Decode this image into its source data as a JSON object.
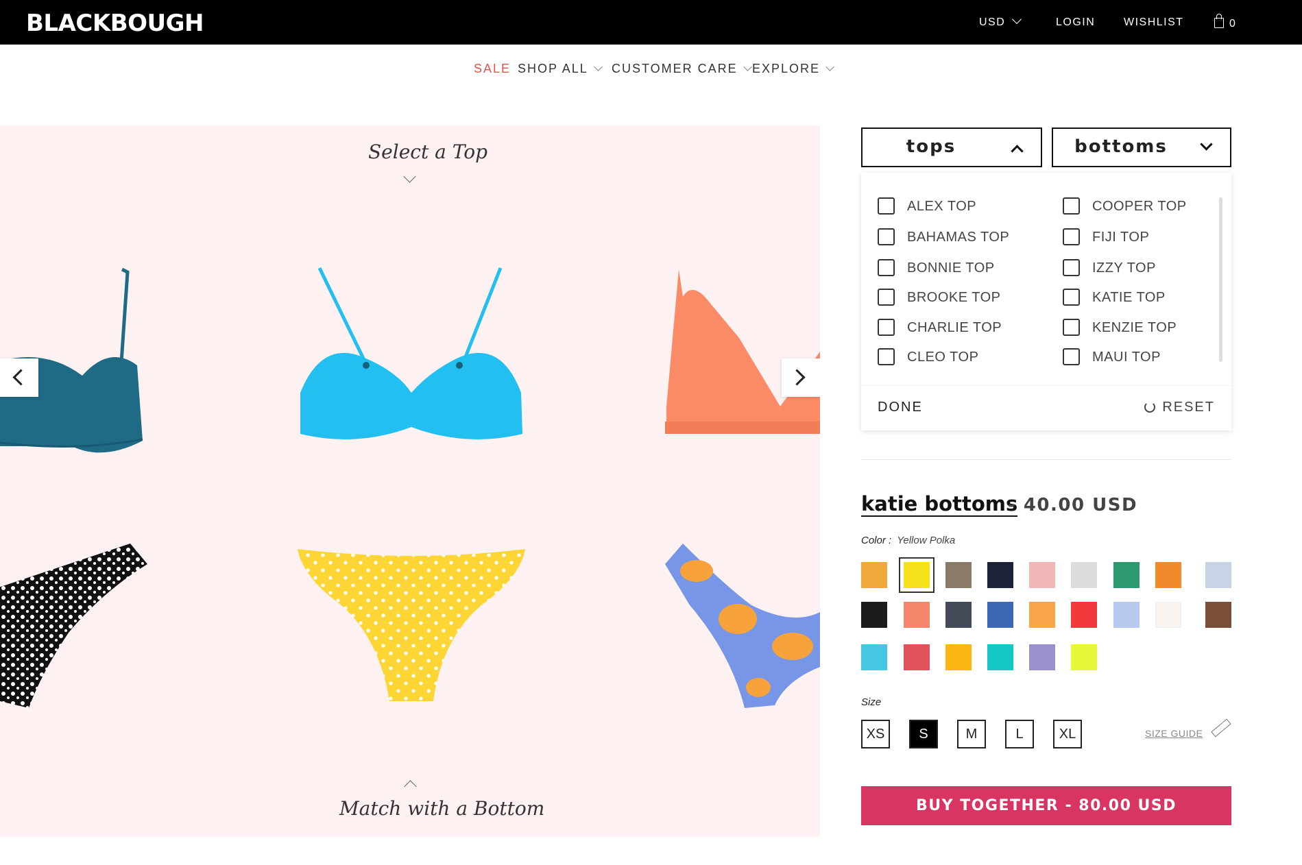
{
  "header": {
    "logo": "BLACKBOUGH",
    "currency": "USD",
    "login": "LOGIN",
    "wishlist": "WISHLIST",
    "cart_count": "0"
  },
  "nav": [
    {
      "label": "SALE"
    },
    {
      "label": "SHOP ALL"
    },
    {
      "label": "CUSTOMER CARE"
    },
    {
      "label": "EXPLORE"
    }
  ],
  "builder": {
    "top_heading": "Select a Top",
    "bottom_heading": "Match with a Bottom",
    "tops": [
      {
        "name": "teal-underwire-top",
        "color": "#1f6b86"
      },
      {
        "name": "aqua-underwire-top",
        "color": "#22bff0"
      },
      {
        "name": "coral-triangle-top",
        "color": "#fb8b66"
      }
    ],
    "bottoms": [
      {
        "name": "black-white-dot-bottom",
        "color": "#111111"
      },
      {
        "name": "yellow-polka-bottom",
        "color": "#fdd535"
      },
      {
        "name": "blue-orange-floral-bottom",
        "color": "#7796e8"
      }
    ]
  },
  "selectors": {
    "tops_label": "tops",
    "bottoms_label": "bottoms"
  },
  "tops_options": {
    "left": [
      "ALEX TOP",
      "BAHAMAS TOP",
      "BONNIE TOP",
      "BROOKE TOP",
      "CHARLIE TOP",
      "CLEO TOP"
    ],
    "right": [
      "COOPER TOP",
      "FIJI TOP",
      "IZZY TOP",
      "KATIE TOP",
      "KENZIE TOP",
      "MAUI TOP"
    ],
    "done": "DONE",
    "reset": "RESET"
  },
  "product": {
    "title": "katie bottoms",
    "price": "- 40.00 USD",
    "color_label": "Color :",
    "color_value": "Yellow Polka",
    "swatches": [
      {
        "name": "multi-print",
        "color": "#f2a93b"
      },
      {
        "name": "yellow-polka",
        "color": "#f6e21b",
        "selected": true
      },
      {
        "name": "snakeskin",
        "color": "#8a7b68"
      },
      {
        "name": "navy-dot",
        "color": "#1c2238"
      },
      {
        "name": "blush",
        "color": "#f0b7b9"
      },
      {
        "name": "light-grey",
        "color": "#dddddd"
      },
      {
        "name": "tropical",
        "color": "#2c9a6e"
      },
      {
        "name": "orange-tile",
        "color": "#f08a2a"
      },
      {
        "name": "pastel-stripe",
        "color": "#c7d4e8"
      },
      {
        "name": "black",
        "color": "#1c1c1c"
      },
      {
        "name": "coral-stripe",
        "color": "#f4846a"
      },
      {
        "name": "charcoal",
        "color": "#444b58"
      },
      {
        "name": "blue-floral",
        "color": "#3b67b5"
      },
      {
        "name": "orange",
        "color": "#faa44c"
      },
      {
        "name": "red",
        "color": "#f23a3d"
      },
      {
        "name": "blue-stripe",
        "color": "#b7c9ef"
      },
      {
        "name": "cream",
        "color": "#faf4f1"
      },
      {
        "name": "brown-snake",
        "color": "#7a4e38"
      },
      {
        "name": "turquoise",
        "color": "#45c7e2"
      },
      {
        "name": "red-gingham",
        "color": "#e2525a"
      },
      {
        "name": "golden",
        "color": "#fbb514"
      },
      {
        "name": "teal-dot",
        "color": "#15c8c6"
      },
      {
        "name": "lavender",
        "color": "#9b90cb"
      },
      {
        "name": "lime",
        "color": "#e7f83a"
      }
    ],
    "size_label": "Size",
    "sizes": [
      {
        "label": "XS"
      },
      {
        "label": "S",
        "selected": true
      },
      {
        "label": "M"
      },
      {
        "label": "L"
      },
      {
        "label": "XL"
      }
    ],
    "size_guide": "SIZE GUIDE",
    "buy_label": "BUY TOGETHER - 80.00 USD"
  },
  "colors": {
    "accent": "#d83563",
    "sale": "#e0524e",
    "panel_bg": "#fdf1f2"
  }
}
